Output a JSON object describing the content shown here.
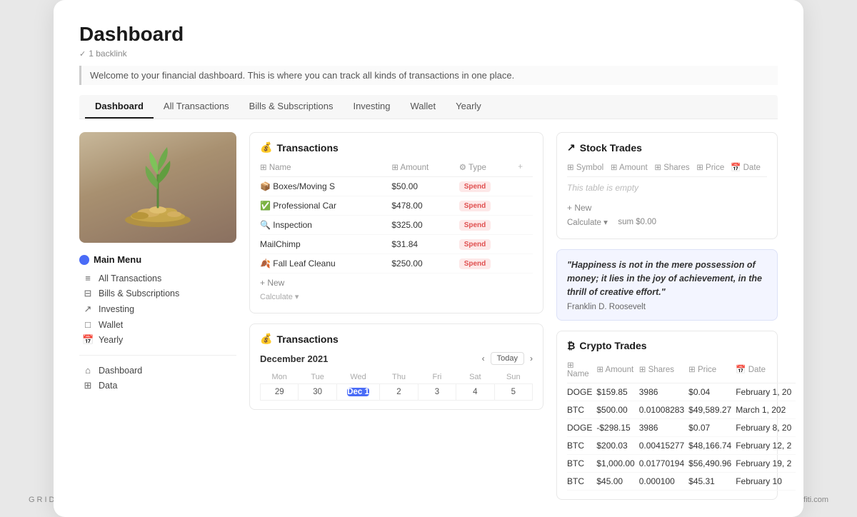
{
  "footer": {
    "left": "GRIDFITI",
    "right": "gridfiti.com"
  },
  "page": {
    "title": "Dashboard",
    "backlink": "1 backlink",
    "intro": "Welcome to your financial dashboard. This is where you can track all kinds of transactions in one place."
  },
  "nav": {
    "items": [
      {
        "label": "Dashboard",
        "active": true
      },
      {
        "label": "All Transactions",
        "active": false
      },
      {
        "label": "Bills & Subscriptions",
        "active": false
      },
      {
        "label": "Investing",
        "active": false
      },
      {
        "label": "Wallet",
        "active": false
      },
      {
        "label": "Yearly",
        "active": false
      }
    ]
  },
  "sidebar": {
    "menu_header": "Main Menu",
    "items": [
      {
        "icon": "≡",
        "label": "All Transactions"
      },
      {
        "icon": "⊟",
        "label": "Bills & Subscriptions"
      },
      {
        "icon": "↗",
        "label": "Investing"
      },
      {
        "icon": "□",
        "label": "Wallet"
      },
      {
        "icon": "📅",
        "label": "Yearly"
      }
    ],
    "section2": [
      {
        "icon": "⌂",
        "label": "Dashboard"
      },
      {
        "icon": "⊞",
        "label": "Data"
      }
    ]
  },
  "transactions": {
    "title": "Transactions",
    "icon": "💰",
    "columns": [
      "Name",
      "Amount",
      "Type"
    ],
    "rows": [
      {
        "icon": "📦",
        "name": "Boxes/Moving S",
        "amount": "$50.00",
        "type": "Spend"
      },
      {
        "icon": "✅",
        "name": "Professional Car",
        "amount": "$478.00",
        "type": "Spend"
      },
      {
        "icon": "🔍",
        "name": "Inspection",
        "amount": "$325.00",
        "type": "Spend"
      },
      {
        "icon": "",
        "name": "MailChimp",
        "amount": "$31.84",
        "type": "Spend"
      },
      {
        "icon": "🍂",
        "name": "Fall Leaf Cleanu",
        "amount": "$250.00",
        "type": "Spend"
      }
    ],
    "add_label": "+ New",
    "calc_label": "Calculate ▾"
  },
  "calendar": {
    "title": "Transactions",
    "icon": "💰",
    "month": "December 2021",
    "today_label": "Today",
    "days": [
      "Mon",
      "Tue",
      "Wed",
      "Thu",
      "Fri",
      "Sat",
      "Sun"
    ],
    "weeks": [
      [
        "29",
        "30",
        "Dec 1",
        "2",
        "3",
        "4",
        "5"
      ]
    ]
  },
  "stock_trades": {
    "title": "Stock Trades",
    "icon": "↗",
    "columns": [
      "Symbol",
      "Amount",
      "Shares",
      "Price",
      "Date"
    ],
    "empty_msg": "This table is empty",
    "add_label": "+ New",
    "sum_label": "sum $0.00",
    "calc_label": "Calculate ▾"
  },
  "quote": {
    "text": "\"Happiness is not in the mere possession of money; it lies in the joy of achievement, in the thrill of creative effort.\"",
    "author": "Franklin D. Roosevelt"
  },
  "crypto_trades": {
    "title": "Crypto Trades",
    "icon": "₿",
    "columns": [
      "Name",
      "Amount",
      "Shares",
      "Price",
      "Date"
    ],
    "rows": [
      {
        "name": "DOGE",
        "amount": "$159.85",
        "shares": "3986",
        "price": "$0.04",
        "date": "February 1, 20",
        "neg": false
      },
      {
        "name": "BTC",
        "amount": "$500.00",
        "shares": "0.01008283",
        "price": "$49,589.27",
        "date": "March 1, 202",
        "neg": false
      },
      {
        "name": "DOGE",
        "amount": "-$298.15",
        "shares": "3986",
        "price": "$0.07",
        "date": "February 8, 20",
        "neg": true
      },
      {
        "name": "BTC",
        "amount": "$200.03",
        "shares": "0.00415277",
        "price": "$48,166.74",
        "date": "February 12, 2",
        "neg": false
      },
      {
        "name": "BTC",
        "amount": "$1,000.00",
        "shares": "0.01770194",
        "price": "$56,490.96",
        "date": "February 19, 2",
        "neg": false
      },
      {
        "name": "BTC",
        "amount": "$45.00",
        "shares": "0.000100",
        "price": "$45.31",
        "date": "February 10",
        "neg": false
      }
    ]
  }
}
